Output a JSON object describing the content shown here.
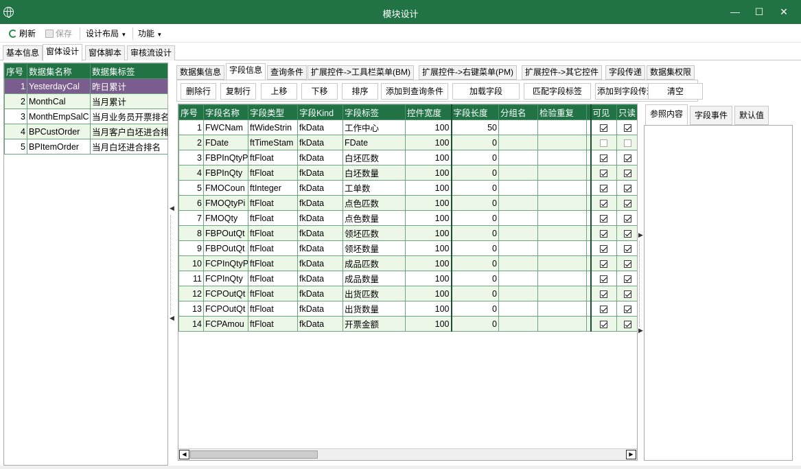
{
  "window": {
    "title": "模块设计",
    "minimize": "—",
    "maximize": "☐",
    "close": "✕"
  },
  "toolbar": {
    "refresh": "刷新",
    "save": "保存",
    "layout": "设计布局",
    "function": "功能"
  },
  "outer_tabs": [
    "基本信息",
    "窗体设计",
    "窗体脚本",
    "审核流设计"
  ],
  "datasets": {
    "headers": [
      "序号",
      "数据集名称",
      "数据集标签"
    ],
    "rows": [
      {
        "no": "1",
        "name": "YesterdayCal",
        "label": "昨日累计"
      },
      {
        "no": "2",
        "name": "MonthCal",
        "label": "当月累计"
      },
      {
        "no": "3",
        "name": "MonthEmpSalC",
        "label": "当月业务员开票排名"
      },
      {
        "no": "4",
        "name": "BPCustOrder",
        "label": "当月客户白坯进合排"
      },
      {
        "no": "5",
        "name": "BPItemOrder",
        "label": "当月白坯进合排名"
      }
    ]
  },
  "inner_tabs": [
    "数据集信息",
    "字段信息",
    "查询条件",
    "扩展控件->工具栏菜单(BM)",
    "扩展控件->右键菜单(PM)",
    "扩展控件->其它控件",
    "字段传递",
    "数据集权限"
  ],
  "actions": [
    "删除行",
    "复制行",
    "上移",
    "下移",
    "排序",
    "添加到查询条件",
    "加载字段",
    "匹配字段标签",
    "添加到字段传递",
    "清空"
  ],
  "fields": {
    "headers": [
      "序号",
      "字段名称",
      "字段类型",
      "字段Kind",
      "字段标签",
      "控件宽度",
      "字段长度",
      "分组名",
      "检验重复",
      "",
      "可见",
      "只读"
    ],
    "rows": [
      {
        "no": "1",
        "name": "FWCNam",
        "type": "ftWideStrin",
        "kind": "fkData",
        "label": "工作中心",
        "width": "100",
        "length": "50",
        "visible": true,
        "readonly": true
      },
      {
        "no": "2",
        "name": "FDate",
        "type": "ftTimeStam",
        "kind": "fkData",
        "label": "FDate",
        "width": "100",
        "length": "0",
        "visible": false,
        "readonly": false
      },
      {
        "no": "3",
        "name": "FBPInQtyP",
        "type": "ftFloat",
        "kind": "fkData",
        "label": "白坯匹数",
        "width": "100",
        "length": "0",
        "visible": true,
        "readonly": true
      },
      {
        "no": "4",
        "name": "FBPInQty",
        "type": "ftFloat",
        "kind": "fkData",
        "label": "白坯数量",
        "width": "100",
        "length": "0",
        "visible": true,
        "readonly": true
      },
      {
        "no": "5",
        "name": "FMOCoun",
        "type": "ftInteger",
        "kind": "fkData",
        "label": "工单数",
        "width": "100",
        "length": "0",
        "visible": true,
        "readonly": true
      },
      {
        "no": "6",
        "name": "FMOQtyPi",
        "type": "ftFloat",
        "kind": "fkData",
        "label": "点色匹数",
        "width": "100",
        "length": "0",
        "visible": true,
        "readonly": true
      },
      {
        "no": "7",
        "name": "FMOQty",
        "type": "ftFloat",
        "kind": "fkData",
        "label": "点色数量",
        "width": "100",
        "length": "0",
        "visible": true,
        "readonly": true
      },
      {
        "no": "8",
        "name": "FBPOutQt",
        "type": "ftFloat",
        "kind": "fkData",
        "label": "领坯匹数",
        "width": "100",
        "length": "0",
        "visible": true,
        "readonly": true
      },
      {
        "no": "9",
        "name": "FBPOutQt",
        "type": "ftFloat",
        "kind": "fkData",
        "label": "领坯数量",
        "width": "100",
        "length": "0",
        "visible": true,
        "readonly": true
      },
      {
        "no": "10",
        "name": "FCPInQtyP",
        "type": "ftFloat",
        "kind": "fkData",
        "label": "成品匹数",
        "width": "100",
        "length": "0",
        "visible": true,
        "readonly": true
      },
      {
        "no": "11",
        "name": "FCPInQty",
        "type": "ftFloat",
        "kind": "fkData",
        "label": "成品数量",
        "width": "100",
        "length": "0",
        "visible": true,
        "readonly": true
      },
      {
        "no": "12",
        "name": "FCPOutQt",
        "type": "ftFloat",
        "kind": "fkData",
        "label": "出货匹数",
        "width": "100",
        "length": "0",
        "visible": true,
        "readonly": true
      },
      {
        "no": "13",
        "name": "FCPOutQt",
        "type": "ftFloat",
        "kind": "fkData",
        "label": "出货数量",
        "width": "100",
        "length": "0",
        "visible": true,
        "readonly": true
      },
      {
        "no": "14",
        "name": "FCPAmou",
        "type": "ftFloat",
        "kind": "fkData",
        "label": "开票金额",
        "width": "100",
        "length": "0",
        "visible": true,
        "readonly": true
      }
    ]
  },
  "right_tabs": [
    "参照内容",
    "字段事件",
    "默认值"
  ],
  "colors": {
    "accent": "#217346",
    "selected_row": "#7a5c8e",
    "alt_row": "#edf7e8"
  }
}
